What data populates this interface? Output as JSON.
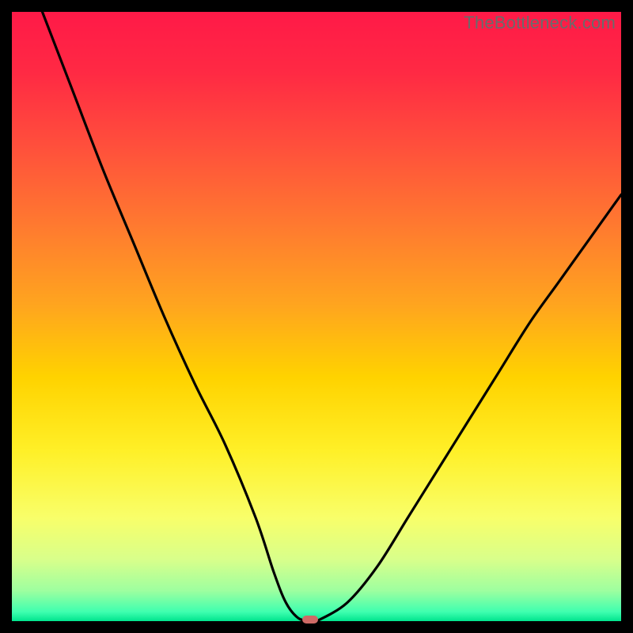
{
  "watermark": "TheBottleneck.com",
  "colors": {
    "black": "#000000",
    "marker": "#cf6a66",
    "curve": "#000000",
    "gradient_stops": [
      {
        "offset": 0.0,
        "color": "#ff1a48"
      },
      {
        "offset": 0.1,
        "color": "#ff2a44"
      },
      {
        "offset": 0.22,
        "color": "#ff503c"
      },
      {
        "offset": 0.35,
        "color": "#ff7a30"
      },
      {
        "offset": 0.48,
        "color": "#ffa51f"
      },
      {
        "offset": 0.6,
        "color": "#ffd300"
      },
      {
        "offset": 0.72,
        "color": "#fff028"
      },
      {
        "offset": 0.83,
        "color": "#f9ff6a"
      },
      {
        "offset": 0.9,
        "color": "#d8ff8c"
      },
      {
        "offset": 0.95,
        "color": "#9effa0"
      },
      {
        "offset": 0.985,
        "color": "#3fffb0"
      },
      {
        "offset": 1.0,
        "color": "#00e58e"
      }
    ]
  },
  "chart_data": {
    "type": "line",
    "title": "",
    "xlabel": "",
    "ylabel": "",
    "xlim": [
      0,
      100
    ],
    "ylim": [
      0,
      100
    ],
    "series": [
      {
        "name": "bottleneck-curve",
        "x": [
          5,
          10,
          15,
          20,
          25,
          30,
          35,
          40,
          43,
          45,
          47,
          49,
          50,
          55,
          60,
          65,
          70,
          75,
          80,
          85,
          90,
          95,
          100
        ],
        "y": [
          100,
          87,
          74,
          62,
          50,
          39,
          29,
          17,
          8,
          3,
          0.5,
          0,
          0,
          3,
          9,
          17,
          25,
          33,
          41,
          49,
          56,
          63,
          70
        ]
      }
    ],
    "marker": {
      "x": 49,
      "y": 0
    },
    "notes": "V-shaped bottleneck curve; minimum (0) around x≈49; left branch rises to 100 at x≈5; right branch rises to ≈70 at x=100. Values estimated from pixels."
  }
}
